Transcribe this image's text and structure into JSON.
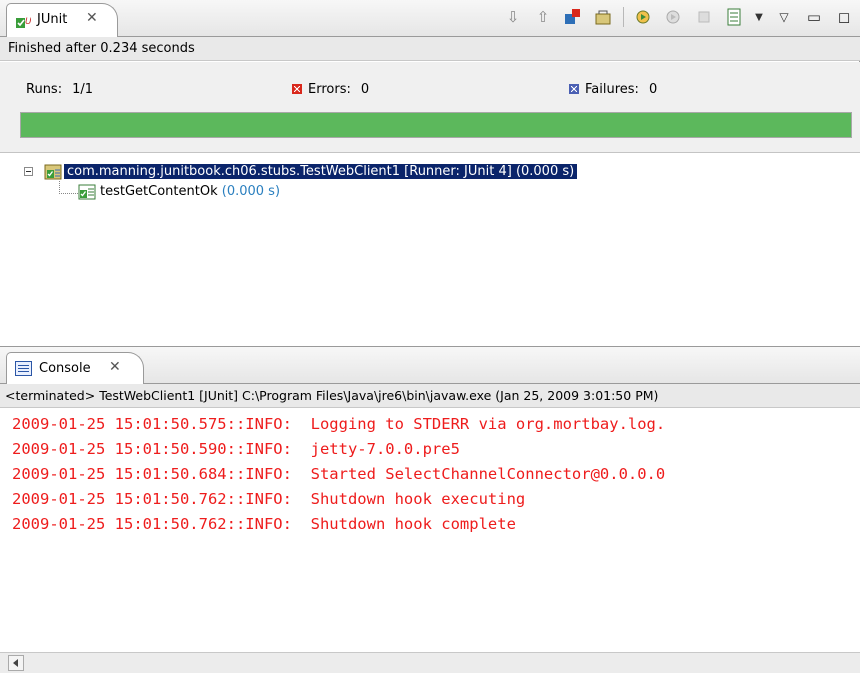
{
  "junit": {
    "tab_title": "JUnit",
    "close_glyph": "✕",
    "status": "Finished after 0.234 seconds",
    "runs_label": "Runs:",
    "runs_value": "1/1",
    "errors_label": "Errors:",
    "errors_value": "0",
    "failures_label": "Failures:",
    "failures_value": "0",
    "progress_fraction": 1.0,
    "progress_color": "#5cb85c",
    "toolbar_icons": [
      "next-failure-icon",
      "previous-failure-icon",
      "show-failures-only-icon",
      "scroll-lock-icon",
      "rerun-test-icon",
      "rerun-failed-first-icon",
      "stop-icon",
      "test-run-history-icon",
      "dropdown-icon",
      "view-menu-icon",
      "minimize-icon",
      "maximize-icon"
    ],
    "tree": {
      "suite_label": "com.manning.junitbook.ch06.stubs.TestWebClient1 [Runner: JUnit 4] (0.000 s)",
      "test_name": "testGetContentOk",
      "test_time": "(0.000 s)"
    }
  },
  "console": {
    "tab_title": "Console",
    "close_glyph": "✕",
    "process": "<terminated> TestWebClient1 [JUnit] C:\\Program Files\\Java\\jre6\\bin\\javaw.exe (Jan 25, 2009 3:01:50 PM)",
    "log_color": "#ee1c1c",
    "lines": [
      "2009-01-25 15:01:50.575::INFO:  Logging to STDERR via org.mortbay.log.",
      "2009-01-25 15:01:50.590::INFO:  jetty-7.0.0.pre5",
      "2009-01-25 15:01:50.684::INFO:  Started SelectChannelConnector@0.0.0.0",
      "2009-01-25 15:01:50.762::INFO:  Shutdown hook executing",
      "2009-01-25 15:01:50.762::INFO:  Shutdown hook complete"
    ]
  }
}
